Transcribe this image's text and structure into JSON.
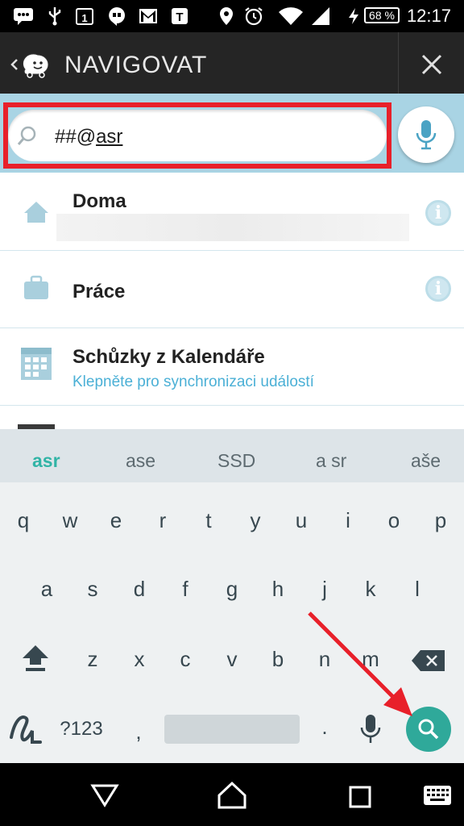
{
  "status_bar": {
    "time": "12:17",
    "battery": "68 %",
    "icons": [
      "chat-icon",
      "usb-icon",
      "calendar-1-icon",
      "hangouts-icon",
      "gmail-icon",
      "t-icon",
      "location-icon",
      "alarm-icon",
      "wifi-icon",
      "signal-icon",
      "charging-icon",
      "battery-icon"
    ]
  },
  "header": {
    "title": "NAVIGOVAT",
    "back_icon": "chevron-left-icon",
    "logo_icon": "waze-logo-icon",
    "close_icon": "close-icon"
  },
  "search": {
    "prefix": "##@",
    "value": "asr",
    "icon": "search-icon",
    "mic_icon": "mic-icon"
  },
  "list": [
    {
      "title": "Doma",
      "subtitle": "",
      "icon": "home-icon",
      "info": "i"
    },
    {
      "title": "Práce",
      "subtitle": "",
      "icon": "briefcase-icon",
      "info": "i"
    },
    {
      "title": "Schůzky z Kalendáře",
      "subtitle": "Klepněte pro synchronizaci událostí",
      "icon": "calendar-icon"
    }
  ],
  "suggestions": [
    "asr",
    "ase",
    "SSD",
    "a sr",
    "aše"
  ],
  "keyboard": {
    "row1": [
      "q",
      "w",
      "e",
      "r",
      "t",
      "y",
      "u",
      "i",
      "o",
      "p"
    ],
    "row2": [
      "a",
      "s",
      "d",
      "f",
      "g",
      "h",
      "j",
      "k",
      "l"
    ],
    "row3": [
      "z",
      "x",
      "c",
      "v",
      "b",
      "n",
      "m"
    ],
    "symbols": "?123",
    "comma": ",",
    "period": "."
  },
  "colors": {
    "accent": "#2fa99a",
    "highlight": "#e8202a",
    "strip": "#a9d4e4",
    "link": "#4bb0d6"
  }
}
